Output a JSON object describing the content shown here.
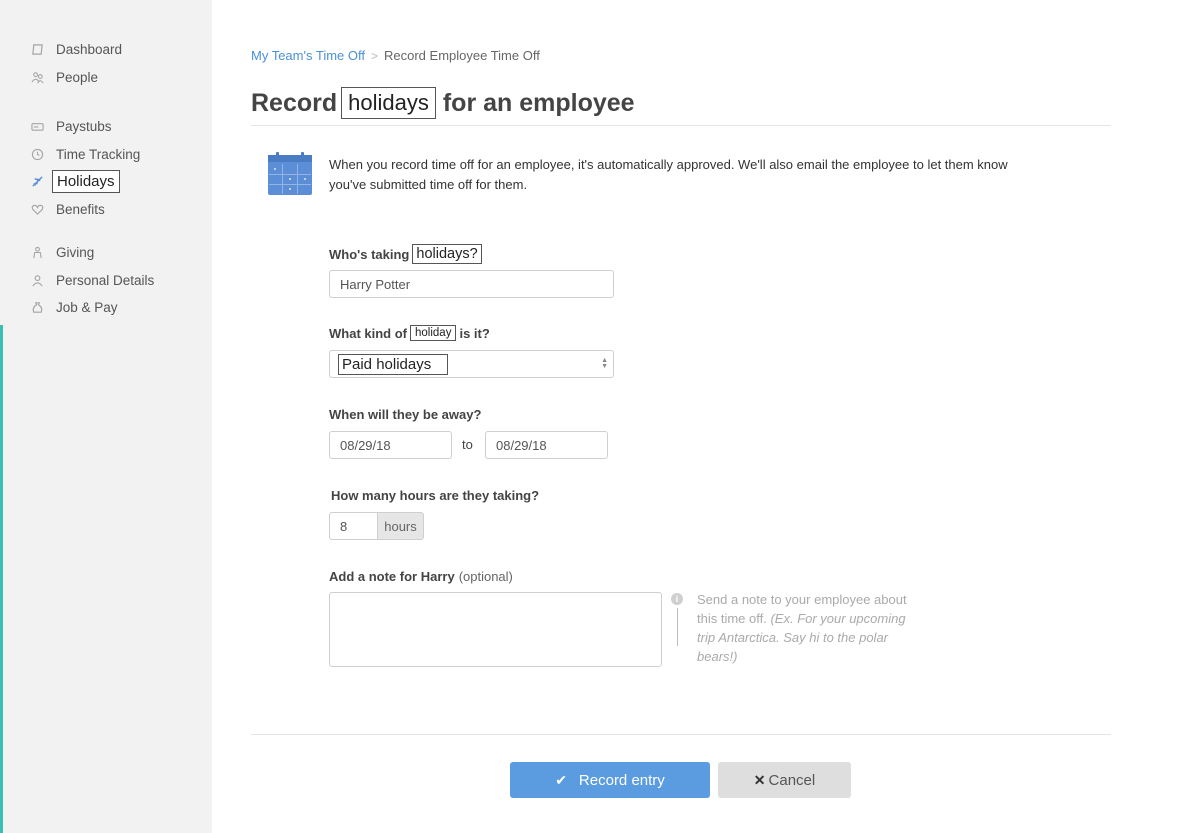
{
  "sidebar": {
    "items": [
      {
        "label": "Dashboard",
        "icon": "dashboard-icon"
      },
      {
        "label": "People",
        "icon": "people-icon"
      },
      {
        "label": "Paystubs",
        "icon": "paystubs-icon"
      },
      {
        "label": "Time Tracking",
        "icon": "clock-icon"
      },
      {
        "label": "Holidays",
        "icon": "plane-icon",
        "active": true
      },
      {
        "label": "Benefits",
        "icon": "heart-icon"
      },
      {
        "label": "Giving",
        "icon": "giving-icon"
      },
      {
        "label": "Personal Details",
        "icon": "person-icon"
      },
      {
        "label": "Job & Pay",
        "icon": "money-bag-icon"
      }
    ],
    "accent_color": "#3bbfb3"
  },
  "breadcrumb": {
    "parent": "My Team's Time Off",
    "separator": ">",
    "current": "Record Employee Time Off"
  },
  "page": {
    "title_prefix": "Record",
    "title_highlight": "holidays",
    "title_suffix": "for an employee"
  },
  "info": {
    "text": "When you record time off for an employee, it's automatically approved. We'll also email the employee to let them know you've submitted time off for them."
  },
  "form": {
    "employee": {
      "label_prefix": "Who's taking",
      "label_highlight": "holidays?",
      "value": "Harry Potter"
    },
    "kind": {
      "label_prefix": "What kind of",
      "label_highlight": "holiday",
      "label_suffix": "is it?",
      "selected": "Paid holidays"
    },
    "dates": {
      "label": "When will they be away?",
      "from": "08/29/18",
      "to_label": "to",
      "to": "08/29/18"
    },
    "hours": {
      "label": "How many hours are they taking?",
      "value": "8",
      "unit": "hours"
    },
    "note": {
      "label": "Add a note for Harry",
      "optional": "(optional)",
      "help_text": "Send a note to your employee about this time off.",
      "help_example": "(Ex. For your upcoming trip Antarctica. Say hi to the polar bears!)"
    }
  },
  "actions": {
    "submit_label": "Record entry",
    "cancel_label": "Cancel"
  },
  "colors": {
    "primary": "#5b9be0",
    "link": "#4a90d9",
    "calendar": "#5b8ed6"
  }
}
